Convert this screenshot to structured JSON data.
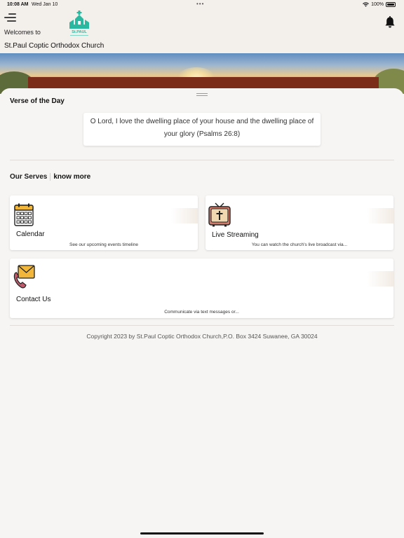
{
  "status_bar": {
    "time": "10:08 AM",
    "date": "Wed Jan 10",
    "battery": "100%"
  },
  "header": {
    "welcome": "Welcomes to",
    "church_name": "St.Paul Coptic Orthodox Church",
    "logo_text": "St.PAUL"
  },
  "verse": {
    "title": "Verse of the Day",
    "text": "O Lord, I love the dwelling place of your house and the dwelling place of your glory (Psalms 26:8)"
  },
  "serves": {
    "title": "Our Serves",
    "know_more": "know more",
    "cards": [
      {
        "title": "Calendar",
        "desc": "See our upcoming events  timeline",
        "icon": "calendar-icon"
      },
      {
        "title": "Live Streaming",
        "desc": "You can watch the church's live broadcast via...",
        "icon": "tv-icon"
      },
      {
        "title": "Contact Us",
        "desc": "Communicate via text messages or...",
        "icon": "contact-icon"
      }
    ]
  },
  "footer": {
    "copyright": "Copyright 2023 by St.Paul Coptic Orthodox Church,P.O. Box 3424 Suwanee, GA 30024"
  },
  "colors": {
    "background": "#f7f5f3",
    "header_background": "#f3efeb",
    "logo_green": "#2bb8a0",
    "card_background": "#ffffff"
  }
}
